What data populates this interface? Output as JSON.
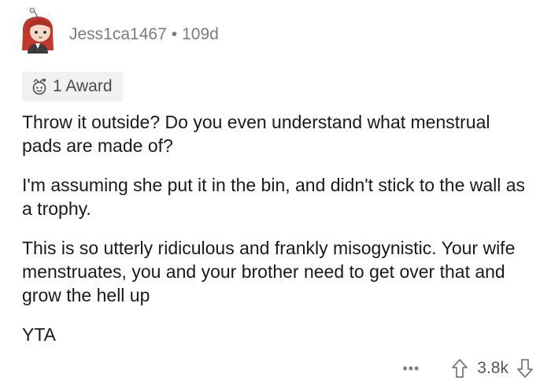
{
  "comment": {
    "author": "Jess1ca1467",
    "separator": "•",
    "age": "109d",
    "award_label": "1 Award",
    "paragraphs": [
      "Throw it outside? Do you even understand what menstrual pads are made of?",
      "I'm assuming she put it in the bin, and didn't stick to the wall as a trophy.",
      "This is so utterly ridiculous and frankly misogynistic. Your wife menstruates, you and your brother need to get over that and grow the hell up",
      "YTA"
    ],
    "more_label": "•••",
    "score": "3.8k"
  },
  "colors": {
    "meta_text": "#7c7c7c",
    "body_text": "#1a1a1b",
    "award_bg": "#f1f1f2",
    "avatar_hair": "#c0392b"
  }
}
